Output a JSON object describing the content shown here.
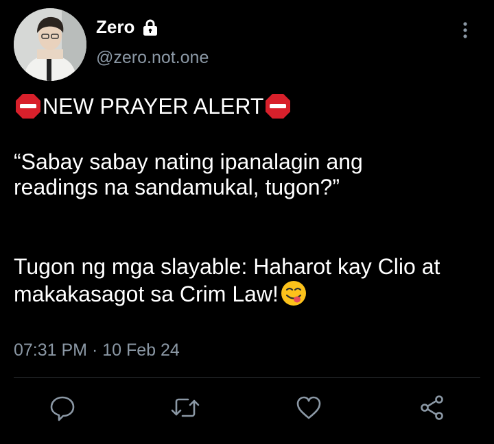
{
  "tweet": {
    "author": {
      "display_name": "Zero",
      "handle": "@zero.not.one",
      "protected_icon": "lock-icon",
      "avatar": "avatar"
    },
    "body": {
      "alert_emoji": "stop-sign-emoji",
      "alert_text": "NEW PRAYER ALERT",
      "quote_line1": "“Sabay sabay nating ipanalagin ang",
      "quote_line2": "readings na sandamukal, tugon?”",
      "response_line1": "Tugon ng mga slayable: Haharot kay Clio at",
      "response_line2": "makakasagot sa Crim Law!",
      "trailing_emoji": "face-savoring-food-emoji"
    },
    "timestamp": "07:31 PM · 10 Feb 24"
  },
  "actions": [
    {
      "name": "reply",
      "icon": "reply-icon"
    },
    {
      "name": "retweet",
      "icon": "retweet-icon"
    },
    {
      "name": "like",
      "icon": "heart-icon"
    },
    {
      "name": "share",
      "icon": "share-icon"
    }
  ],
  "colors": {
    "background": "#000000",
    "text": "#ffffff",
    "secondary_text": "#8b98a5",
    "divider": "#2f3336",
    "stop_sign": "#d8202b"
  }
}
